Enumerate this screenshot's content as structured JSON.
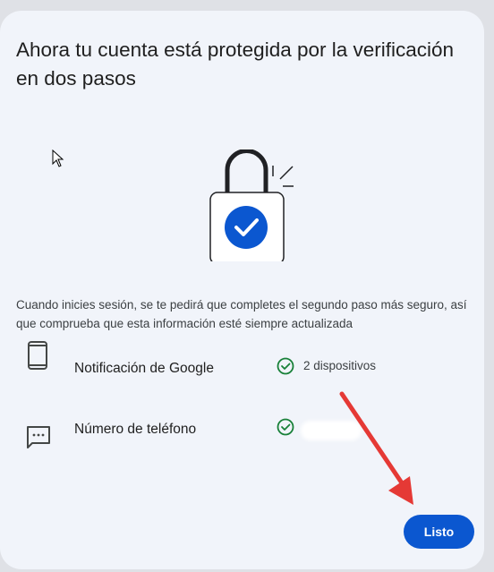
{
  "dialog": {
    "title": "Ahora tu cuenta está protegida por la verificación en dos pasos",
    "description": "Cuando inicies sesión, se te pedirá que completes el segundo paso más seguro, así que comprueba que esta información esté siempre actualizada",
    "illustration_icon": "padlock-check-icon",
    "methods": [
      {
        "icon": "phone-icon",
        "label": "Notificación de Google",
        "status": "2 dispositivos",
        "status_icon": "check-circle-icon"
      },
      {
        "icon": "sms-icon",
        "label": "Número de teléfono",
        "status": "",
        "status_icon": "check-circle-icon"
      }
    ],
    "done_label": "Listo"
  },
  "colors": {
    "accent": "#0b57d0",
    "check": "#188038",
    "annotation_arrow": "#e53935"
  }
}
